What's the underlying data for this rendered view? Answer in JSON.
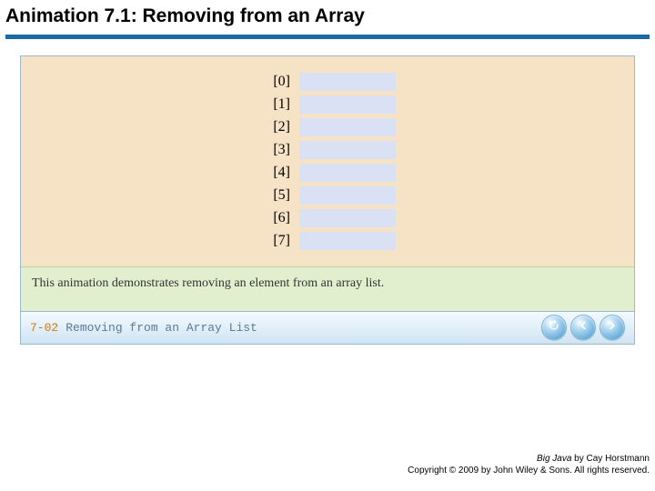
{
  "title": "Animation 7.1: Removing from an Array",
  "array": {
    "indices": [
      "[0]",
      "[1]",
      "[2]",
      "[3]",
      "[4]",
      "[5]",
      "[6]",
      "[7]"
    ]
  },
  "description": "This animation demonstrates removing an element from an array list.",
  "navbar": {
    "code": "7-02",
    "title": "Removing from an Array List",
    "buttons": {
      "reload": "reload",
      "prev": "previous",
      "next": "next"
    }
  },
  "footer": {
    "book_title": "Big Java",
    "byline_rest": " by Cay Horstmann",
    "copyright": "Copyright © 2009 by John Wiley & Sons. All rights reserved."
  }
}
